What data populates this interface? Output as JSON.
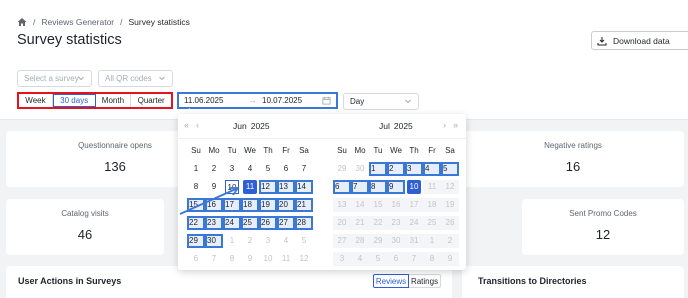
{
  "breadcrumb": {
    "items": [
      "Reviews Generator",
      "Survey statistics"
    ]
  },
  "page": {
    "title": "Survey statistics"
  },
  "toolbar": {
    "download_label": "Download data"
  },
  "filters": {
    "survey_placeholder": "Select a survey",
    "qr_placeholder": "All QR codes",
    "periods": [
      "Week",
      "30 days",
      "Month",
      "Quarter"
    ],
    "active_period": "30 days",
    "date_from": "11.06.2025",
    "date_to": "10.07.2025",
    "granularity": "Day"
  },
  "stats": [
    {
      "label": "Questionnaire opens",
      "value": "136"
    },
    {
      "label": "Negative ratings",
      "value": "16"
    },
    {
      "label": "Catalog visits",
      "value": "46"
    },
    {
      "label": "Sent Promo Codes",
      "value": "12"
    }
  ],
  "sections": {
    "user_actions_title": "User Actions in Surveys",
    "toggle_reviews": "Reviews",
    "toggle_ratings": "Ratings",
    "transitions_title": "Transitions to Directories"
  },
  "calendar": {
    "weekdays": [
      "Su",
      "Mo",
      "Tu",
      "We",
      "Th",
      "Fr",
      "Sa"
    ],
    "nav": {
      "prev_year": "«",
      "prev_month": "‹",
      "next_month": "›",
      "next_year": "»"
    },
    "left": {
      "month": "Jun",
      "year": "2025",
      "weeks": [
        [
          "1",
          "2",
          "3",
          "4",
          "5",
          "6",
          "7"
        ],
        [
          "8",
          "9",
          "10",
          "11",
          "12",
          "13",
          "14"
        ],
        [
          "15",
          "16",
          "17",
          "18",
          "19",
          "20",
          "21"
        ],
        [
          "22",
          "23",
          "24",
          "25",
          "26",
          "27",
          "28"
        ],
        [
          "29",
          "30",
          "1",
          "2",
          "3",
          "4",
          "5"
        ],
        [
          "6",
          "7",
          "8",
          "9",
          "10",
          "11",
          "12"
        ]
      ]
    },
    "right": {
      "month": "Jul",
      "year": "2025",
      "weeks": [
        [
          "29",
          "30",
          "1",
          "2",
          "3",
          "4",
          "5"
        ],
        [
          "6",
          "7",
          "8",
          "9",
          "10",
          "11",
          "12"
        ],
        [
          "13",
          "14",
          "15",
          "16",
          "17",
          "18",
          "19"
        ],
        [
          "20",
          "21",
          "22",
          "23",
          "24",
          "25",
          "26"
        ],
        [
          "27",
          "28",
          "29",
          "30",
          "31",
          "1",
          "2"
        ],
        [
          "3",
          "4",
          "5",
          "6",
          "7",
          "8",
          "9"
        ]
      ]
    }
  }
}
